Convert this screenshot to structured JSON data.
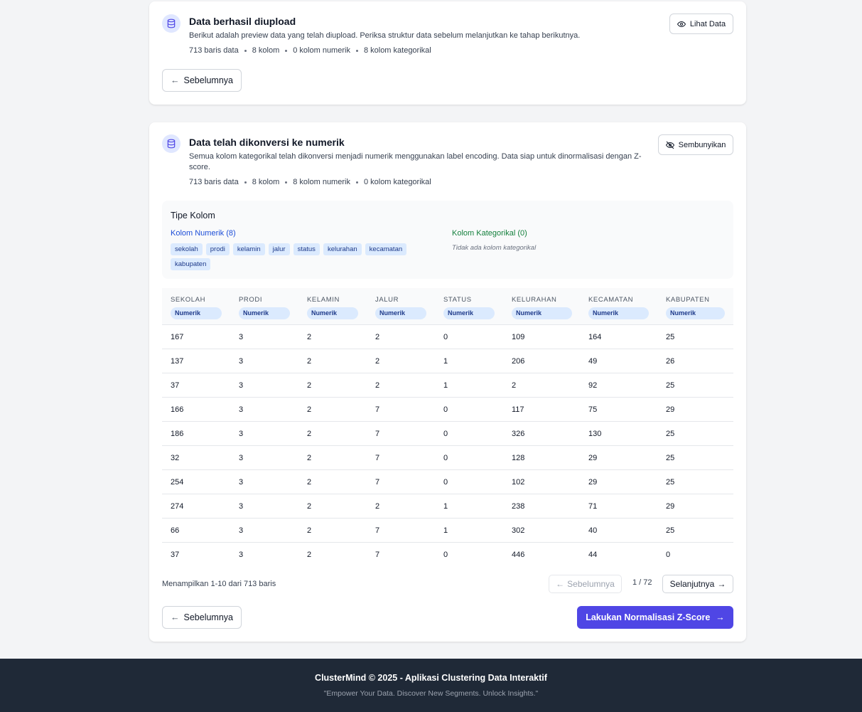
{
  "upload_card": {
    "title": "Data berhasil diupload",
    "description": "Berikut adalah preview data yang telah diupload. Periksa struktur data sebelum melanjutkan ke tahap berikutnya.",
    "stats": [
      "713 baris data",
      "8 kolom",
      "0 kolom numerik",
      "8 kolom kategorikal"
    ],
    "view_button": "Lihat Data",
    "prev_button": "Sebelumnya",
    "icon": "database-icon"
  },
  "convert_card": {
    "title": "Data telah dikonversi ke numerik",
    "description": "Semua kolom kategorikal telah dikonversi menjadi numerik menggunakan label encoding. Data siap untuk dinormalisasi dengan Z-score.",
    "stats": [
      "713 baris data",
      "8 kolom",
      "8 kolom numerik",
      "0 kolom kategorikal"
    ],
    "hide_button": "Sembunyikan",
    "icon": "database-icon",
    "column_types": {
      "title": "Tipe Kolom",
      "numeric_title": "Kolom Numerik (8)",
      "numeric_columns": [
        "sekolah",
        "prodi",
        "kelamin",
        "jalur",
        "status",
        "kelurahan",
        "kecamatan",
        "kabupaten"
      ],
      "categorical_title": "Kolom Kategorikal (0)",
      "categorical_empty": "Tidak ada kolom kategorikal"
    },
    "table": {
      "headers": [
        "SEKOLAH",
        "PRODI",
        "KELAMIN",
        "JALUR",
        "STATUS",
        "KELURAHAN",
        "KECAMATAN",
        "KABUPATEN"
      ],
      "badge": "Numerik",
      "rows": [
        [
          "167",
          "3",
          "2",
          "2",
          "0",
          "109",
          "164",
          "25"
        ],
        [
          "137",
          "3",
          "2",
          "2",
          "1",
          "206",
          "49",
          "26"
        ],
        [
          "37",
          "3",
          "2",
          "2",
          "1",
          "2",
          "92",
          "25"
        ],
        [
          "166",
          "3",
          "2",
          "7",
          "0",
          "117",
          "75",
          "29"
        ],
        [
          "186",
          "3",
          "2",
          "7",
          "0",
          "326",
          "130",
          "25"
        ],
        [
          "32",
          "3",
          "2",
          "7",
          "0",
          "128",
          "29",
          "25"
        ],
        [
          "254",
          "3",
          "2",
          "7",
          "0",
          "102",
          "29",
          "25"
        ],
        [
          "274",
          "3",
          "2",
          "2",
          "1",
          "238",
          "71",
          "29"
        ],
        [
          "66",
          "3",
          "2",
          "7",
          "1",
          "302",
          "40",
          "25"
        ],
        [
          "37",
          "3",
          "2",
          "7",
          "0",
          "446",
          "44",
          "0"
        ]
      ]
    },
    "pagination": {
      "info": "Menampilkan 1-10 dari 713 baris",
      "prev": "Sebelumnya",
      "page": "1 / 72",
      "next": "Selanjutnya"
    },
    "prev_button": "Sebelumnya",
    "primary_button": "Lakukan Normalisasi Z-Score"
  },
  "footer": {
    "line1": "ClusterMind © 2025 - Aplikasi Clustering Data Interaktif",
    "line2": "\"Empower Your Data. Discover New Segments. Unlock Insights.\""
  },
  "colors": {
    "accent": "#4f46e5",
    "numeric_tag": "#dbeafe",
    "categorical_title": "#15803d",
    "footer_bg": "#1f2937"
  }
}
